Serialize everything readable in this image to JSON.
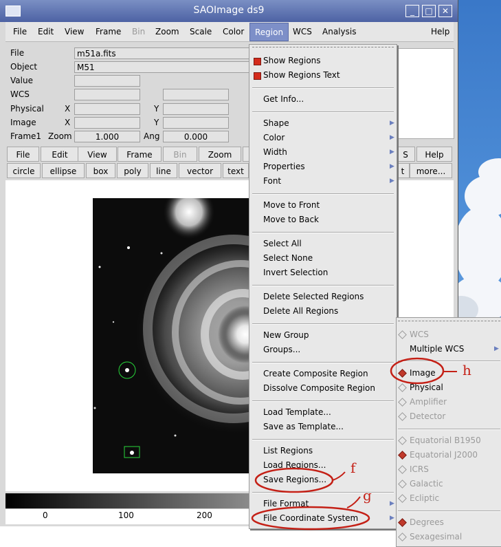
{
  "window": {
    "title": "SAOImage ds9"
  },
  "menubar": [
    {
      "label": "File"
    },
    {
      "label": "Edit"
    },
    {
      "label": "View"
    },
    {
      "label": "Frame"
    },
    {
      "label": "Bin",
      "disabled": true
    },
    {
      "label": "Zoom"
    },
    {
      "label": "Scale"
    },
    {
      "label": "Color"
    },
    {
      "label": "Region",
      "active": true
    },
    {
      "label": "WCS"
    },
    {
      "label": "Analysis"
    },
    {
      "label": "Help"
    }
  ],
  "info": {
    "file_label": "File",
    "file_value": "m51a.fits",
    "object_label": "Object",
    "object_value": "M51",
    "value_label": "Value",
    "wcs_label": "WCS",
    "physical_label": "Physical",
    "image_label": "Image",
    "x_label": "X",
    "y_label": "Y",
    "frame_label": "Frame1",
    "zoom_label": "Zoom",
    "zoom_value": "1.000",
    "ang_label": "Ang",
    "ang_value": "0.000"
  },
  "buttonbar": {
    "row1": [
      "File",
      "Edit",
      "View",
      "Frame",
      "Bin",
      "Zoom",
      "S",
      "Help"
    ],
    "row2": [
      "circle",
      "ellipse",
      "box",
      "poly",
      "line",
      "vector",
      "text",
      "t",
      "more..."
    ]
  },
  "colorbar": {
    "ticks": [
      "0",
      "100",
      "200"
    ]
  },
  "region_menu": {
    "show_regions": "Show Regions",
    "show_regions_text": "Show Regions Text",
    "get_info": "Get Info...",
    "shape": "Shape",
    "color": "Color",
    "width": "Width",
    "properties": "Properties",
    "font": "Font",
    "move_front": "Move to Front",
    "move_back": "Move to Back",
    "select_all": "Select All",
    "select_none": "Select None",
    "invert_selection": "Invert Selection",
    "delete_selected": "Delete Selected Regions",
    "delete_all": "Delete All Regions",
    "new_group": "New Group",
    "groups": "Groups...",
    "create_composite": "Create Composite Region",
    "dissolve_composite": "Dissolve Composite Region",
    "load_template": "Load Template...",
    "save_template": "Save as Template...",
    "list_regions": "List Regions",
    "load_regions": "Load Regions...",
    "save_regions": "Save Regions...",
    "file_format": "File Format",
    "file_coord_system": "File Coordinate System"
  },
  "coord_submenu": {
    "wcs": "WCS",
    "multiple_wcs": "Multiple WCS",
    "image": "Image",
    "physical": "Physical",
    "amplifier": "Amplifier",
    "detector": "Detector",
    "eq_b1950": "Equatorial B1950",
    "eq_j2000": "Equatorial J2000",
    "icrs": "ICRS",
    "galactic": "Galactic",
    "ecliptic": "Ecliptic",
    "degrees": "Degrees",
    "sexagesimal": "Sexagesimal"
  },
  "annotations": {
    "f": "f",
    "g": "g",
    "h": "h"
  },
  "colors": {
    "accent": "#7d8fc8",
    "annotation": "#c42016",
    "checked": "#d42b1c"
  }
}
